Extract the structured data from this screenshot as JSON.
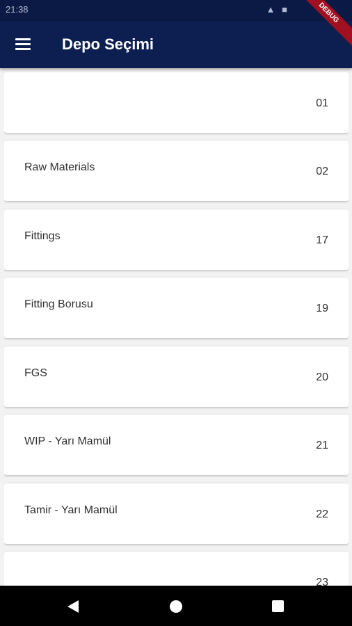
{
  "status_bar": {
    "time": "21:38",
    "icons": "▲ ■"
  },
  "app_bar": {
    "title": "Depo Seçimi",
    "debug_label": "DEBUG"
  },
  "warehouses": [
    {
      "name": "",
      "code": "01"
    },
    {
      "name": "Raw Materials",
      "code": "02"
    },
    {
      "name": "Fittings",
      "code": "17"
    },
    {
      "name": "Fitting Borusu",
      "code": "19"
    },
    {
      "name": "FGS",
      "code": "20"
    },
    {
      "name": "WIP - Yarı Mamül",
      "code": "21"
    },
    {
      "name": "Tamir - Yarı Mamül",
      "code": "22"
    },
    {
      "name": "",
      "code": "23"
    }
  ]
}
